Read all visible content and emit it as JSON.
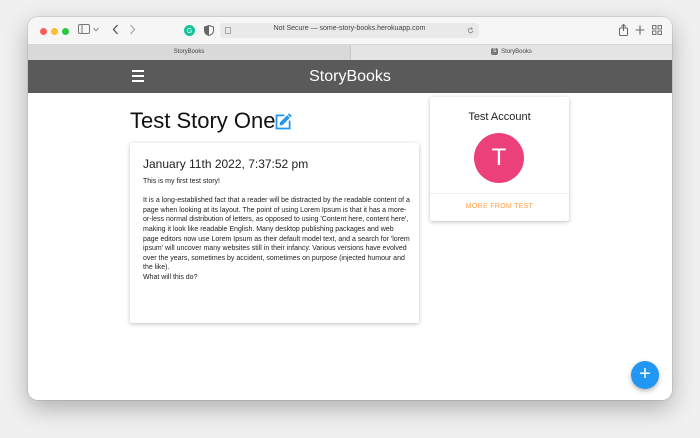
{
  "browser": {
    "url_text": "Not Secure — some-story-books.herokuapp.com",
    "tabs": [
      {
        "label": "StoryBooks"
      },
      {
        "label": "StoryBooks"
      }
    ]
  },
  "navbar": {
    "brand": "StoryBooks"
  },
  "story": {
    "title": "Test Story One",
    "date": "January 11th 2022, 7:37:52 pm",
    "paragraphs": [
      "This is my first test story!",
      "It is a long-established fact that a reader will be distracted by the readable content of a page when looking at its layout. The point of using Lorem Ipsum is that it has a more-or-less normal distribution of letters, as opposed to using 'Content here, content here', making it look like readable English. Many desktop publishing packages and web page editors now use Lorem Ipsum as their default model text, and a search for 'lorem ipsum' will uncover many websites still in their infancy. Various versions have evolved over the years, sometimes by accident, sometimes on purpose (injected humour and the like).",
      "What will this do?"
    ]
  },
  "profile": {
    "name": "Test Account",
    "initial": "T",
    "more_link": "MORE FROM TEST"
  },
  "fab": {
    "label": "+"
  },
  "colors": {
    "navbar": "#5a5a5a",
    "avatar": "#ec407a",
    "link": "#ff9f43",
    "fab": "#2196f3",
    "edit_icon": "#2196f3"
  },
  "icons": [
    "menu-icon",
    "edit-icon",
    "add-icon",
    "share-icon",
    "new-tab-icon",
    "tab-overview-icon",
    "sidebar-icon",
    "back-icon",
    "forward-icon",
    "shield-icon",
    "reload-icon",
    "extension-icon"
  ]
}
